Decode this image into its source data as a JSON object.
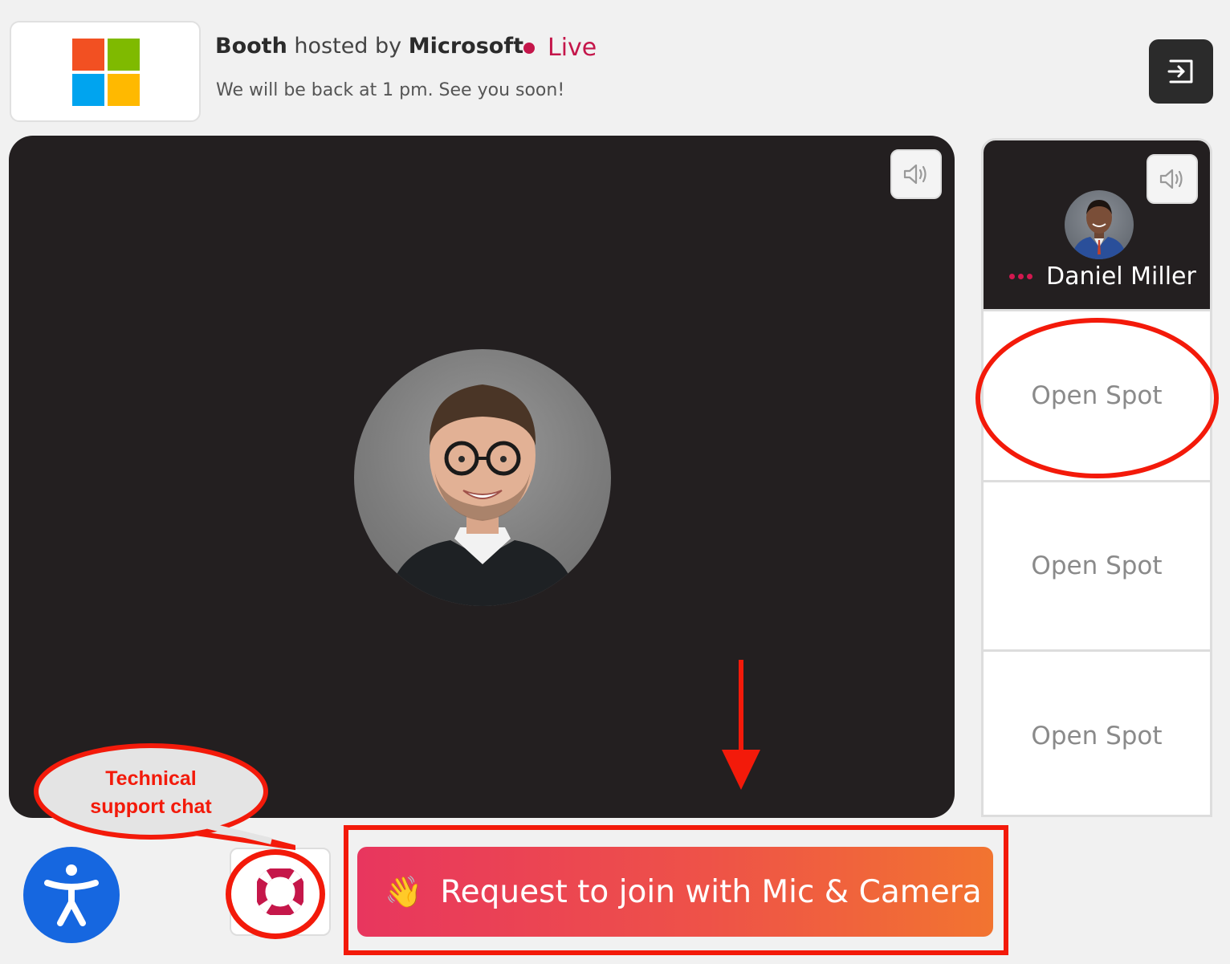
{
  "header": {
    "booth_word": "Booth",
    "hosted_by": "hosted by",
    "company": "Microsoft",
    "live_label": "Live",
    "subtitle": "We will be back at 1 pm. See you soon!",
    "live_color": "#c4164a"
  },
  "icons": {
    "exit": "exit-icon",
    "volume": "volume-icon",
    "accessibility": "accessibility-icon",
    "support": "lifebuoy-icon",
    "wave": "waving-hand-icon"
  },
  "side_panel": {
    "host_name": "Daniel Miller",
    "spots": [
      "Open Spot",
      "Open Spot",
      "Open Spot"
    ]
  },
  "actions": {
    "wave_emoji": "👋",
    "join_label": "Request to join with Mic & Camera",
    "join_gradient": [
      "#e8365e",
      "#f27430"
    ]
  },
  "annotations": {
    "bubble_line1": "Technical",
    "bubble_line2": "support chat",
    "annotation_color": "#f31a0a"
  },
  "colors": {
    "background": "#f1f1f1",
    "stage": "#231f20",
    "accessibility_blue": "#1667e0"
  }
}
